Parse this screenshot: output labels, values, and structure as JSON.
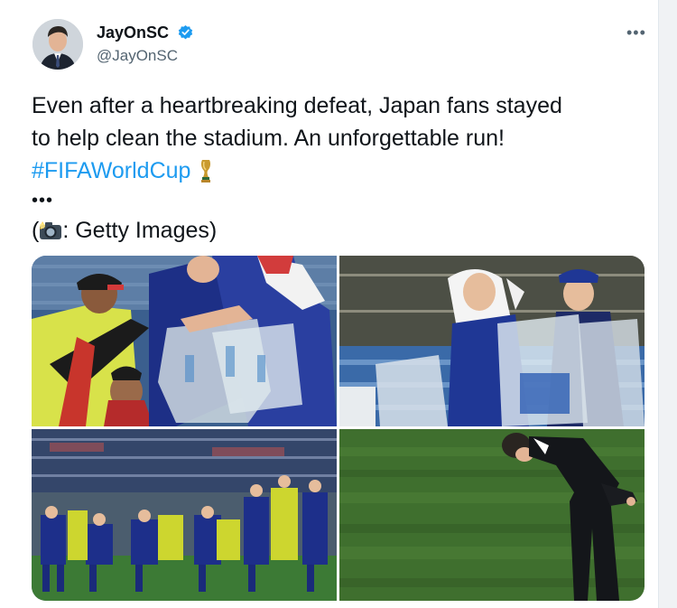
{
  "tweet": {
    "author": {
      "name": "JayOnSC",
      "handle": "@JayOnSC",
      "verified_icon": "verified-badge-icon",
      "avatar": "profile-photo"
    },
    "more_label": "•••",
    "text": {
      "line1": "Even after a heartbreaking defeat, Japan fans stayed",
      "line2": "to help clean the stadium. An unforgettable run!",
      "hashtag": "#FIFAWorldCup",
      "hashtag_icon": "trophy-icon",
      "ellipsis": "•••",
      "credit_prefix": "(",
      "credit_icon": "camera-flash-icon",
      "credit_text": ": Getty Images)"
    },
    "media": {
      "photos": [
        "fans-handing-bags-of-bottles-to-steward",
        "fans-holding-trash-bags-in-stands",
        "japan-players-bowing-to-fans",
        "coach-bowing-on-pitch"
      ]
    }
  },
  "colors": {
    "link": "#1d9bf0",
    "text": "#0f1419",
    "secondary_text": "#536471",
    "japan_blue": "#1b2f8a",
    "pitch_green": "#3f6f2e"
  }
}
